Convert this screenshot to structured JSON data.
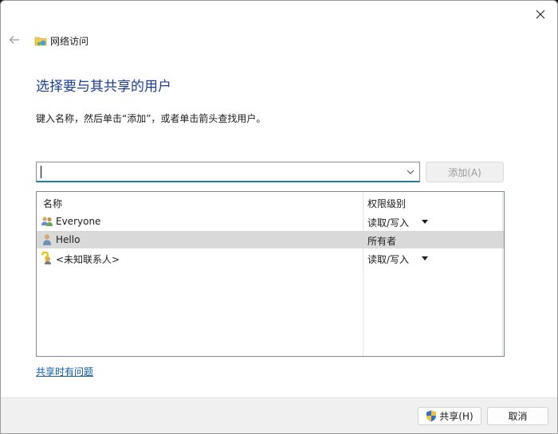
{
  "window": {
    "nav_title": "网络访问",
    "heading": "选择要与其共享的用户",
    "instruction": "键入名称，然后单击“添加”，或者单击箭头查找用户。"
  },
  "combo": {
    "value": ""
  },
  "add_button": {
    "label": "添加(A)"
  },
  "list": {
    "headers": {
      "name": "名称",
      "permission": "权限级别"
    },
    "rows": [
      {
        "name": "Everyone",
        "permission": "读取/写入",
        "icon": "group-icon"
      },
      {
        "name": "Hello",
        "permission": "所有者",
        "icon": "user-icon"
      },
      {
        "name": "<未知联系人>",
        "permission": "读取/写入",
        "icon": "unknown-user-icon"
      }
    ]
  },
  "help_link": "共享时有问题",
  "footer": {
    "share_label": "共享(H)",
    "cancel_label": "取消"
  },
  "colors": {
    "heading": "#1c3f94",
    "link": "#0b5cad",
    "focus": "#1a7fb0",
    "selected_row": "#d9d9d9"
  }
}
